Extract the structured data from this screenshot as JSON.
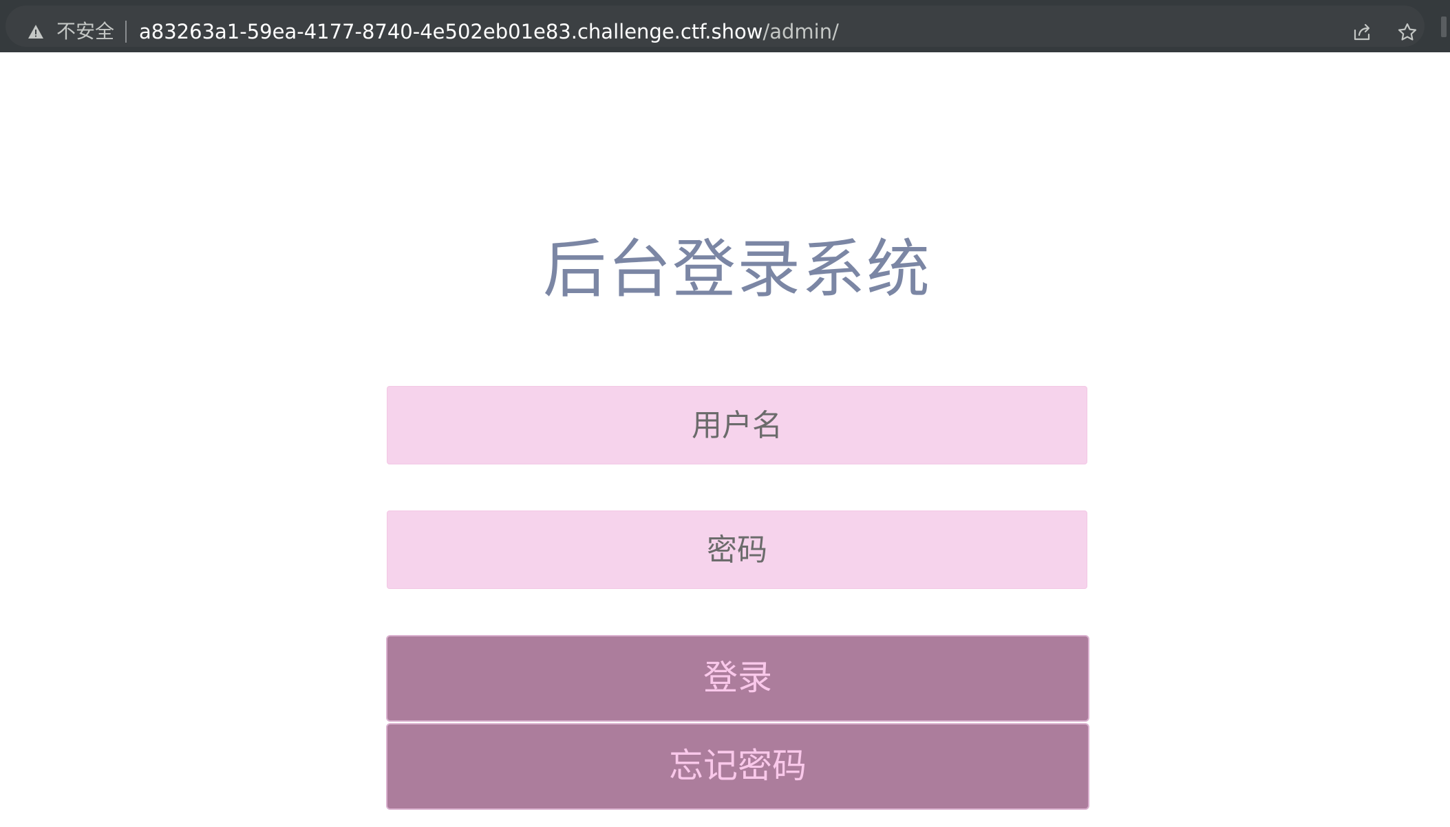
{
  "browser": {
    "security_label": "不安全",
    "url_host": "a83263a1-59ea-4177-8740-4e502eb01e83.challenge.ctf.show",
    "url_path": "/admin/",
    "icons": [
      "warning-icon",
      "share-icon",
      "star-icon"
    ]
  },
  "page": {
    "title": "后台登录系统",
    "username_placeholder": "用户名",
    "password_placeholder": "密码",
    "login_label": "登录",
    "forgot_label": "忘记密码",
    "colors": {
      "title": "#7b86a4",
      "input_bg": "#f6d3ec",
      "button_bg": "#ac7d9c",
      "button_text": "#f9c8ea"
    }
  }
}
